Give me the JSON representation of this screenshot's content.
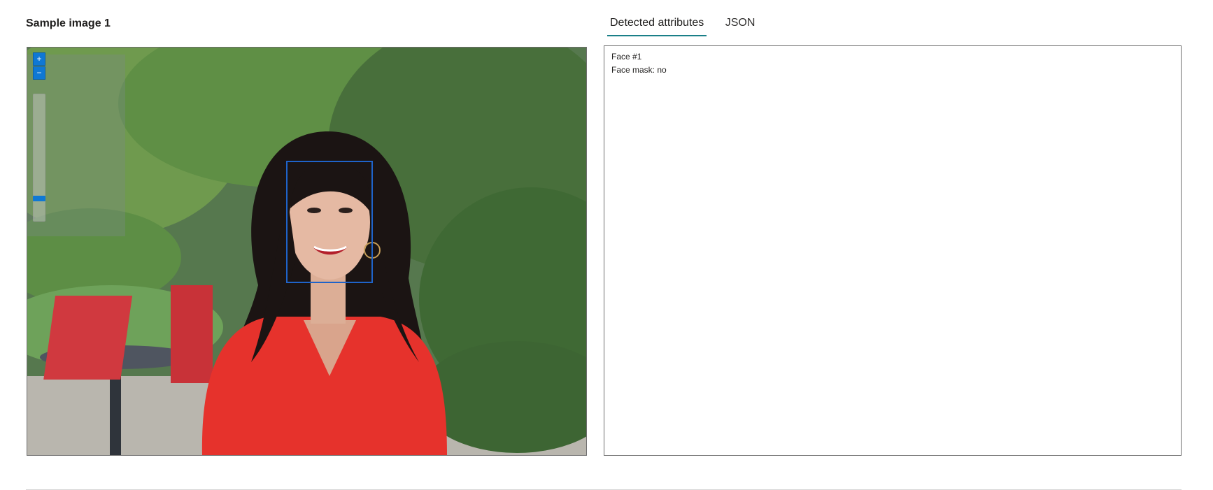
{
  "sample": {
    "title": "Sample image 1"
  },
  "viewer": {
    "zoom_in_label": "+",
    "zoom_out_label": "−",
    "zoom_level": 0.12,
    "detected_face": {
      "label": "Face #1"
    },
    "accent_color": "#0f78d4",
    "face_box_color": "#1f63c9"
  },
  "tabs": [
    {
      "label": "Detected attributes",
      "active": true
    },
    {
      "label": "JSON",
      "active": false
    }
  ],
  "results": {
    "faces": [
      {
        "title": "Face #1",
        "attributes": "Face mask: no"
      }
    ]
  },
  "colors": {
    "tab_underline": "#1a7f88",
    "border": "#6e6e6e"
  }
}
